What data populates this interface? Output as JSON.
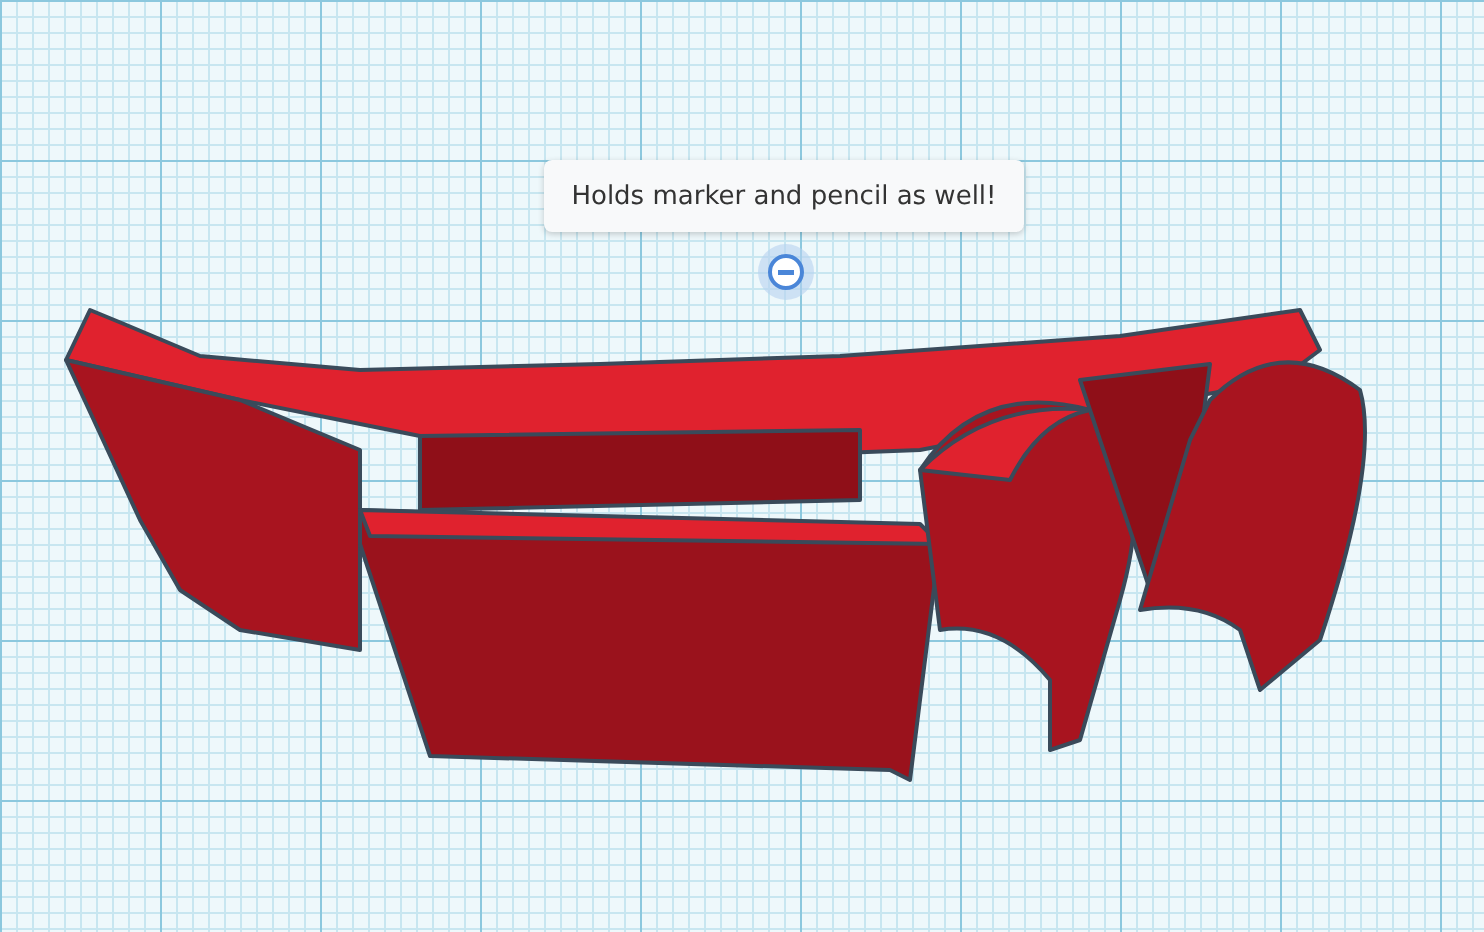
{
  "note": {
    "text": "Holds marker and pencil as well!"
  }
}
